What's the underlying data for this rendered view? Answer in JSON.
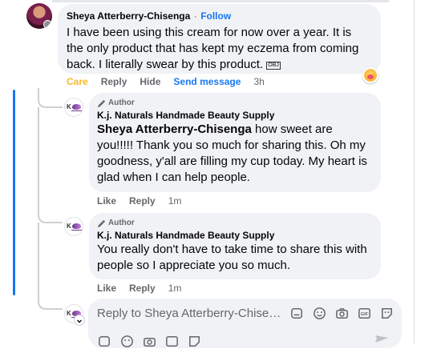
{
  "comment": {
    "author": "Sheya Atterberry-Chisenga",
    "separator": "·",
    "follow_label": "Follow",
    "text": "I have been using this cream for now over a year. It is the only product that has kept my eczema from coming back. I literally swear by this product.",
    "object_glyph": "OBJ",
    "actions": {
      "care": "Care",
      "reply": "Reply",
      "hide": "Hide",
      "send_message": "Send message",
      "time": "3h"
    }
  },
  "replies": [
    {
      "badge": "Author",
      "author": "K.j. Naturals Handmade Beauty Supply",
      "mention": "Sheya Atterberry-Chisenga",
      "text": " how sweet are you!!!!! Thank you so much for sharing this. Oh my goodness, y'all are filling my cup today. My heart is glad when I can help people.",
      "actions": {
        "like": "Like",
        "reply": "Reply",
        "time": "1m"
      }
    },
    {
      "badge": "Author",
      "author": "K.j. Naturals Handmade Beauty Supply",
      "text": "You really don't have to take time to share this with people so I appreciate you so much.",
      "actions": {
        "like": "Like",
        "reply": "Reply",
        "time": "1m"
      }
    }
  ],
  "composer": {
    "placeholder": "Reply to Sheya Atterberry-Chisenga...",
    "tools": [
      "sticker-icon",
      "emoji-icon",
      "camera-icon",
      "gif-icon",
      "avatar-sticker-icon"
    ]
  },
  "brand_avatar_letter": "K",
  "colors": {
    "accent": "#1877f2",
    "care": "#f7b928",
    "bubble": "#f0f2f5",
    "muted": "#65676b"
  }
}
